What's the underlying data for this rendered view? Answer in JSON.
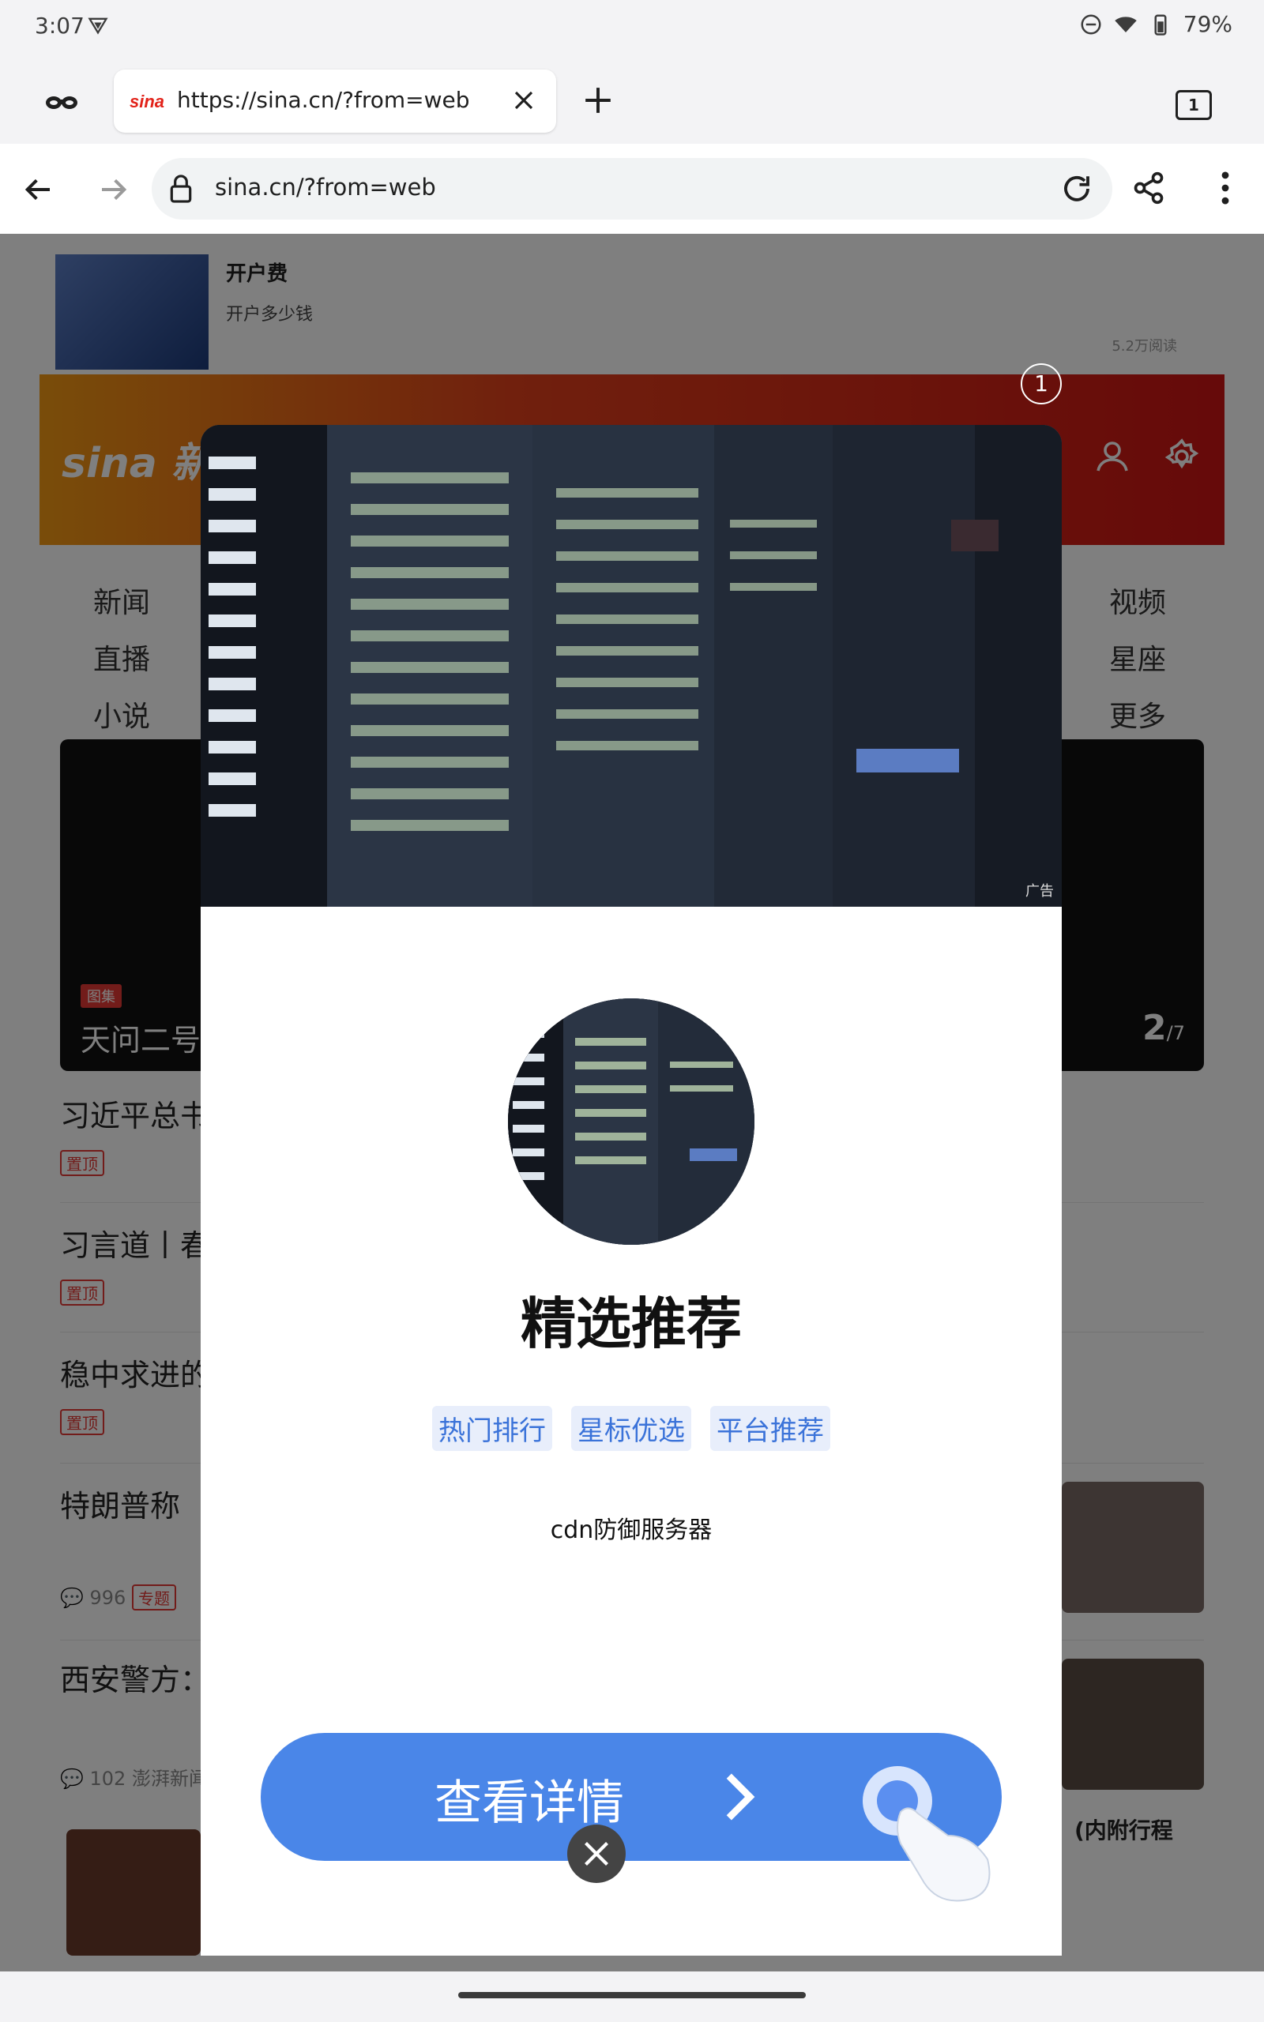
{
  "status_bar": {
    "time": "3:07",
    "battery": "79%"
  },
  "tab": {
    "title": "https://sina.cn/?from=web",
    "count": "1"
  },
  "toolbar": {
    "url": "sina.cn/?from=web"
  },
  "page": {
    "top_ad": {
      "title": "开户费",
      "subtitle": "开户多少钱",
      "views": "5.2万阅读"
    },
    "logo_text": "sina 新浪",
    "nav_left": [
      "新闻",
      "直播",
      "小说"
    ],
    "nav_right": [
      "视频",
      "星座",
      "更多"
    ],
    "gallery": {
      "badge": "图集",
      "title": "天问二号",
      "page": "2",
      "total": "/7"
    },
    "news": [
      {
        "title": "习近平总书",
        "tag": "置顶"
      },
      {
        "title": "习言道丨春",
        "tag": "置顶"
      },
      {
        "title": "稳中求进的",
        "tag": "置顶"
      },
      {
        "title": "特朗普称",
        "comments": "996",
        "tag": "专题"
      },
      {
        "title": "西安警方：",
        "comments": "102",
        "source": "澎湃新闻"
      }
    ],
    "partial_text": "(内附行程"
  },
  "popup": {
    "ad_counter": "1",
    "ad_label": "广告",
    "title": "精选推荐",
    "tags": [
      "热门排行",
      "星标优选",
      "平台推荐"
    ],
    "description": "cdn防御服务器",
    "cta_label": "查看详情"
  },
  "colors": {
    "cta": "#4a86e8",
    "tag_text": "#3b73d9",
    "header_start": "#f39a14",
    "header_end": "#cc1414"
  }
}
